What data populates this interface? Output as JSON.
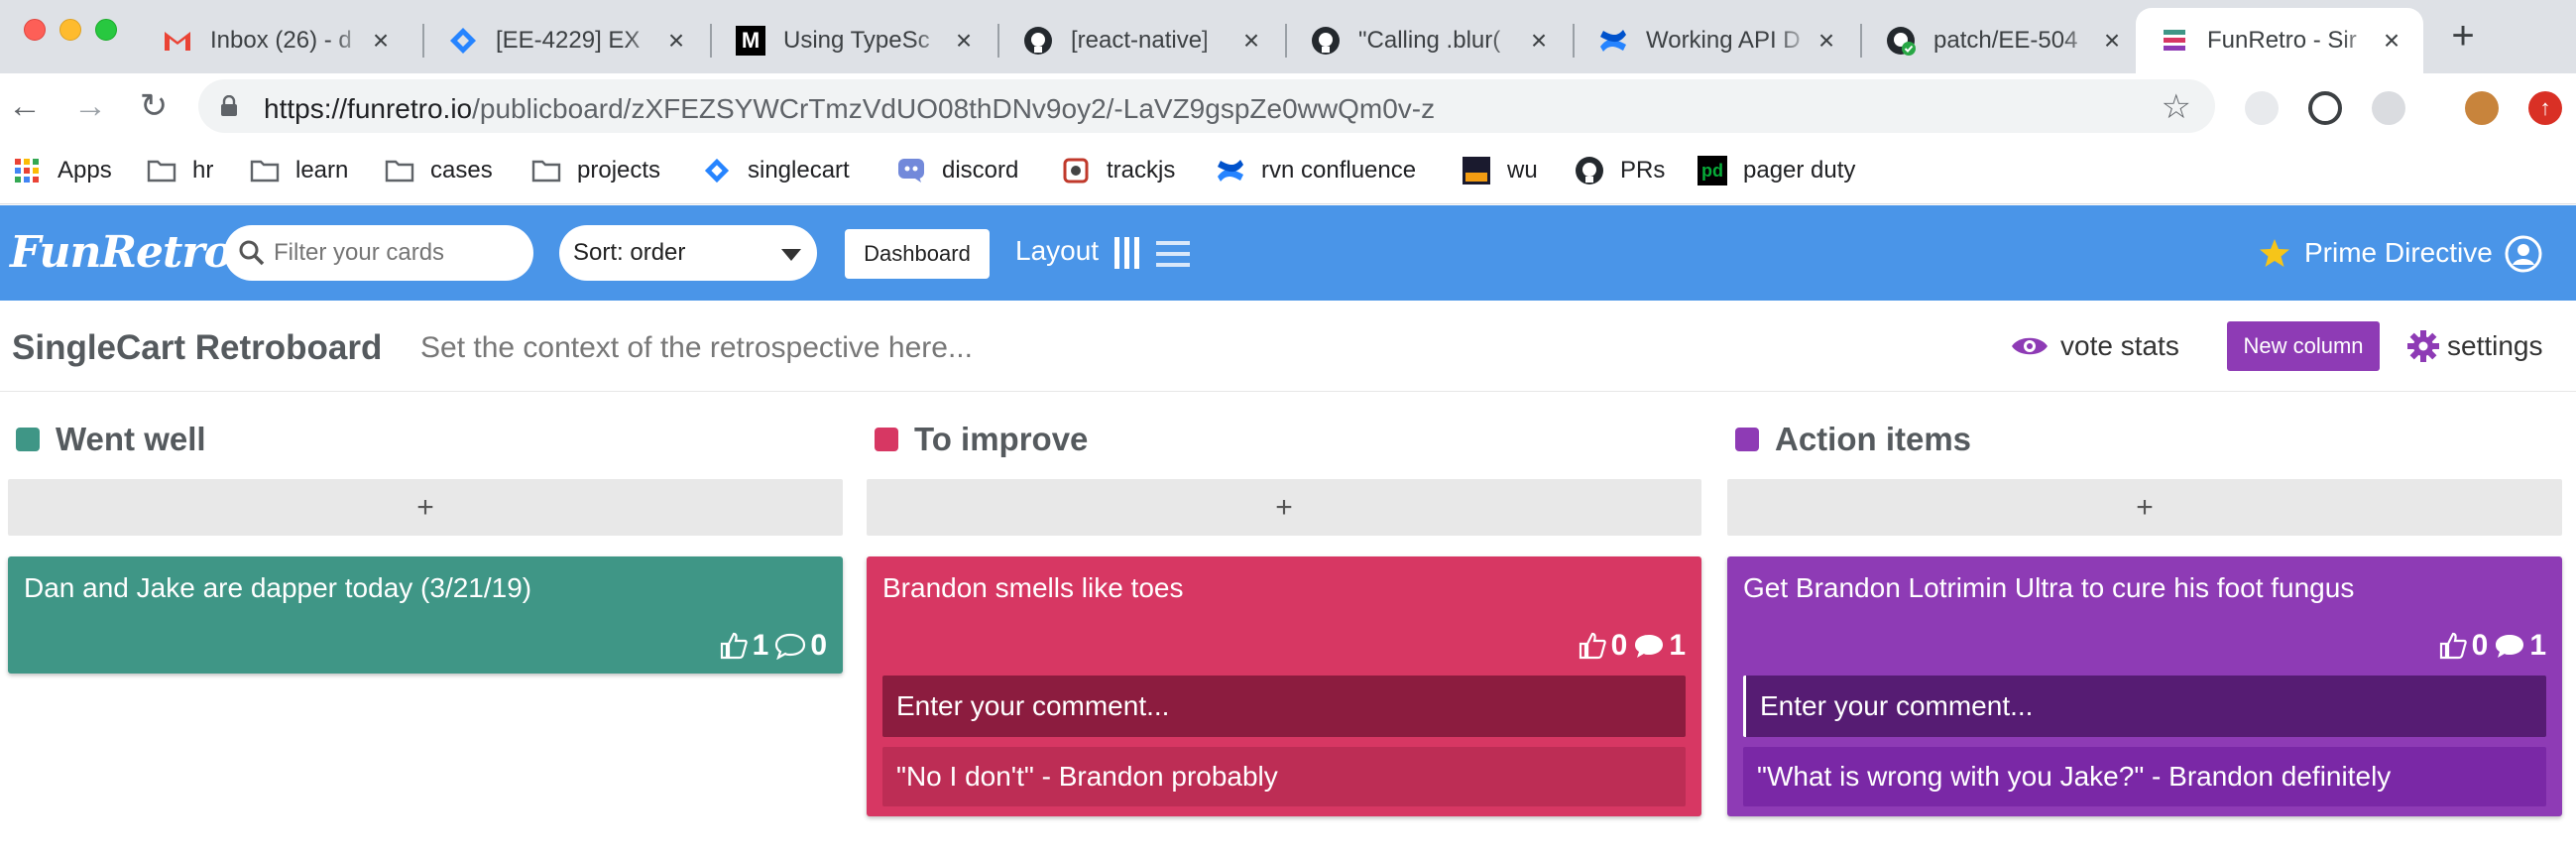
{
  "browser": {
    "tabs": [
      {
        "label": "Inbox (26) - d",
        "icon": "gmail-icon"
      },
      {
        "label": "[EE-4229] EX",
        "icon": "jira-icon"
      },
      {
        "label": "Using TypeSc",
        "icon": "medium-icon"
      },
      {
        "label": "[react-native]",
        "icon": "github-icon"
      },
      {
        "label": "\"Calling .blur(",
        "icon": "github-icon"
      },
      {
        "label": "Working API D",
        "icon": "confluence-icon"
      },
      {
        "label": "patch/EE-504",
        "icon": "github-check-icon"
      },
      {
        "label": "FunRetro - Sir",
        "icon": "funretro-icon",
        "active": true
      }
    ],
    "url_host": "https://funretro.io",
    "url_path": "/publicboard/zXFEZSYWCrTmzVdUO08thDNv9oy2/-LaVZ9gspZe0wwQm0v-z",
    "bookmarks": [
      "Apps",
      "hr",
      "learn",
      "cases",
      "projects",
      "singlecart",
      "discord",
      "trackjs",
      "rvn confluence",
      "wu",
      "PRs",
      "pager duty"
    ]
  },
  "app": {
    "logo": "FunRetro",
    "filter_placeholder": "Filter your cards",
    "sort_label": "Sort: order",
    "dashboard_label": "Dashboard",
    "layout_label": "Layout",
    "prime_directive": "Prime Directive"
  },
  "board": {
    "title": "SingleCart Retroboard",
    "context": "Set the context of the retrospective here...",
    "vote_stats": "vote stats",
    "new_column": "New column",
    "settings": "settings"
  },
  "columns": [
    {
      "title": "Went well",
      "color": "#3f9686",
      "add": "+",
      "cards": [
        {
          "text": "Dan and Jake are dapper today (3/21/19)",
          "likes": "1",
          "comments": "0"
        }
      ]
    },
    {
      "title": "To improve",
      "color": "#d73763",
      "add": "+",
      "cards": [
        {
          "text": "Brandon smells like toes",
          "likes": "0",
          "comments": "1",
          "comment_placeholder": "Enter your comment...",
          "comment_list": [
            "\"No I don't\" - Brandon probably"
          ]
        }
      ]
    },
    {
      "title": "Action items",
      "color": "#8e3bb5",
      "add": "+",
      "cards": [
        {
          "text": "Get Brandon Lotrimin Ultra to cure his foot fungus",
          "likes": "0",
          "comments": "1",
          "comment_placeholder": "Enter your comment...",
          "comment_list": [
            "\"What is wrong with you Jake?\" - Brandon definitely"
          ]
        }
      ]
    }
  ]
}
